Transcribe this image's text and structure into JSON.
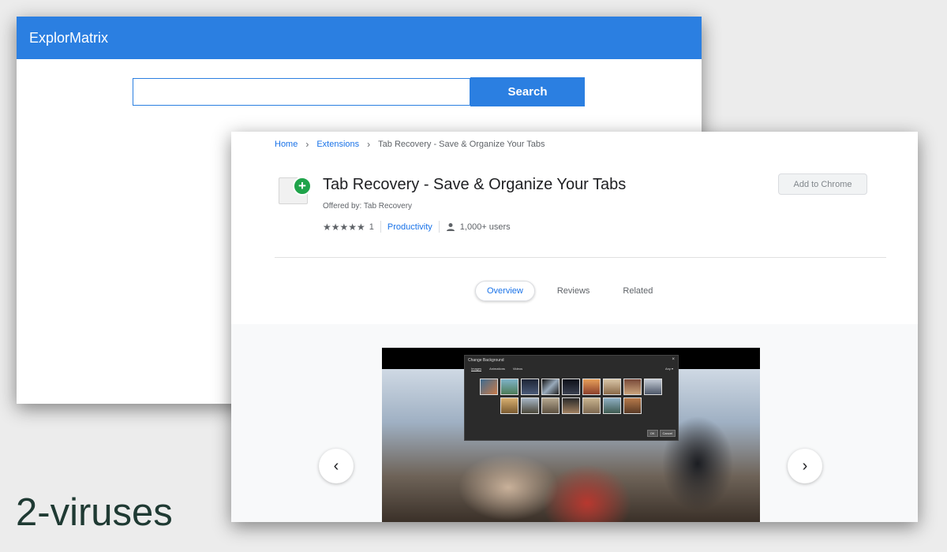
{
  "back_window": {
    "title": "ExplorMatrix",
    "search": {
      "value": "",
      "placeholder": "",
      "button_label": "Search"
    }
  },
  "store": {
    "breadcrumb": {
      "home": "Home",
      "section": "Extensions",
      "current": "Tab Recovery - Save & Organize Your Tabs"
    },
    "extension": {
      "title": "Tab Recovery - Save & Organize Your Tabs",
      "offered_by": "Offered by: Tab Recovery",
      "stars": "★★★★★",
      "rating_count": "1",
      "category": "Productivity",
      "users": "1,000+ users",
      "add_button": "Add to Chrome",
      "icon_badge": "+"
    },
    "tabs": [
      {
        "label": "Overview",
        "active": true
      },
      {
        "label": "Reviews",
        "active": false
      },
      {
        "label": "Related",
        "active": false
      }
    ],
    "screenshot": {
      "dialog_title": "Change Background",
      "close": "×",
      "dialog_tabs": [
        "Images",
        "Animations",
        "Videos"
      ],
      "filter": "Any ▾",
      "ok": "OK",
      "cancel": "Cancel"
    },
    "nav": {
      "prev": "‹",
      "next": "›"
    }
  },
  "watermark": "2-viruses",
  "colors": {
    "accent": "#2b7fe1",
    "link": "#1a73e8",
    "badge": "#1fa34a"
  },
  "icons": [
    "chevron-right-icon",
    "star-icon",
    "user-icon",
    "plus-icon",
    "close-icon",
    "chevron-left-icon"
  ]
}
